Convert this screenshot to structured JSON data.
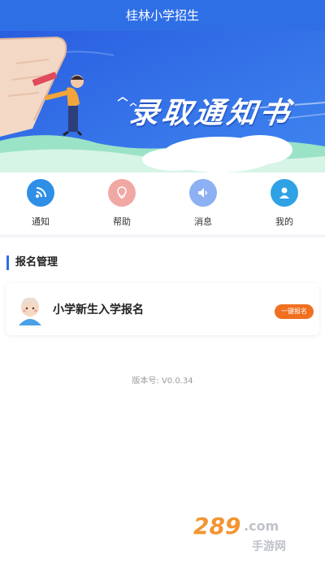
{
  "app": {
    "title": "桂林小学招生"
  },
  "banner": {
    "title": "录取通知书"
  },
  "quick_links": [
    {
      "label": "通知",
      "icon": "signal-icon",
      "color": "#2f8fe6"
    },
    {
      "label": "帮助",
      "icon": "lightbulb-icon",
      "color": "#f1a8a5"
    },
    {
      "label": "消息",
      "icon": "speaker-icon",
      "color": "#8cb0f2"
    },
    {
      "label": "我的",
      "icon": "user-icon",
      "color": "#2fa2e6"
    }
  ],
  "section": {
    "title": "报名管理"
  },
  "enroll_card": {
    "title": "小学新生入学报名",
    "button_label": "一键报名",
    "button_color": "#f0701f",
    "avatar_icon": "student-avatar-icon"
  },
  "footer": {
    "version": "版本号: V0.0.34"
  },
  "watermark": {
    "brand": "289.com",
    "caption": "手游网"
  },
  "colors": {
    "primary": "#2f6fe6",
    "accent": "#f0701f"
  }
}
